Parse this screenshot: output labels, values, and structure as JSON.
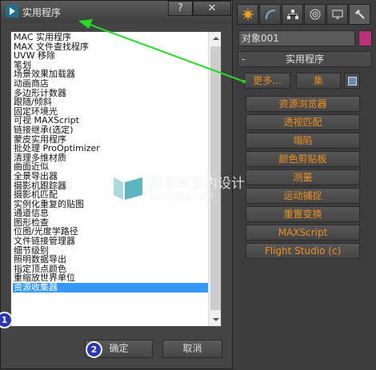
{
  "dialog": {
    "title": "实用程序",
    "help_label": "?",
    "close_label": "✕",
    "items": [
      "MAC 实用程序",
      "MAX 文件查找程序",
      "UVW 移除",
      "笔划",
      "场景效果加载器",
      "动画商店",
      "多边形计数器",
      "跟随/倾斜",
      "固定环境光",
      "可视 MAXScript",
      "链接继承(选定)",
      "蒙皮实用程序",
      "批处理 ProOptimizer",
      "清理多维材质",
      "曲面近似",
      "全景导出器",
      "摄影机跟踪器",
      "摄影机匹配",
      "实例化重复的贴图",
      "通道信息",
      "图形检查",
      "位图/光度学路径",
      "文件链接管理器",
      "细节级别",
      "照明数据导出",
      "指定顶点颜色",
      "重缩放世界单位",
      "资源收集器"
    ],
    "selected_item": "资源收集器",
    "ok_label": "确定",
    "cancel_label": "取消",
    "badge1": "1",
    "badge2": "2"
  },
  "panel": {
    "object_name": "对象001",
    "object_color": "#b9317a",
    "rollout_minus": "-",
    "rollout_title": "实用程序",
    "more_label": "更多...",
    "sets_label": "集",
    "utilities": [
      "资源浏览器",
      "透视匹配",
      "塌陷",
      "颜色剪贴板",
      "测量",
      "运动捕捉",
      "重置变换",
      "MAXScript",
      "Flight Studio (c)"
    ],
    "tabs": [
      "create-icon",
      "modify-icon",
      "hierarchy-icon",
      "motion-icon",
      "display-icon",
      "utilities-icon"
    ]
  },
  "watermark": {
    "title": "扮家家室内设计",
    "url": "banjiajia.com"
  },
  "colors": {
    "selection": "#3399ff",
    "button_text": "#f0901c",
    "arrow": "#22dd22",
    "badge": "#2b35b8"
  }
}
